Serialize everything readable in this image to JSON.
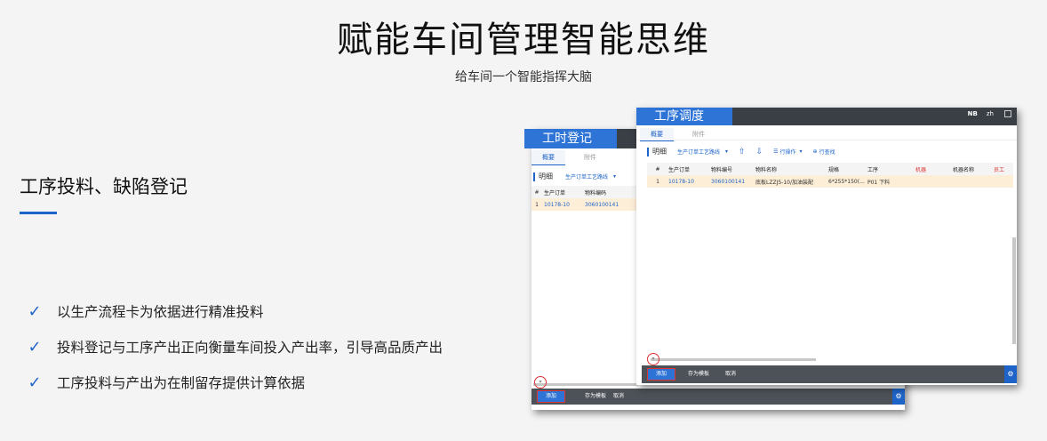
{
  "hero": {
    "title": "赋能车间管理智能思维",
    "subtitle": "给车间一个智能指挥大脑"
  },
  "section": {
    "title": "工序投料、缺陷登记",
    "accent_color": "#1e64c8"
  },
  "bullets": [
    "以生产流程卡为依据进行精准投料",
    "投料登记与工序产出正向衡量车间投入产出率，引导高品质产出",
    "工序投料与产出为在制留存提供计算依据"
  ],
  "icons": {
    "check": "✓",
    "tick": "check-icon",
    "up": "⇧",
    "down": "⇩",
    "caret": "▾",
    "row_op": "☰",
    "fold": "⊕",
    "external": "external-link-icon",
    "settings": "⚙"
  },
  "back_window": {
    "title": "工时登记",
    "tabs": [
      "概要",
      "附件"
    ],
    "detail_label": "明细",
    "view_select": "生产订单工艺路线",
    "columns": [
      "#",
      "生产订单",
      "物料编码"
    ],
    "rows": [
      [
        "1",
        "10178-10",
        "3060100141"
      ]
    ],
    "footer": {
      "add": "添加",
      "save_template": "存为模板",
      "cancel": "取消"
    }
  },
  "front_window": {
    "title": "工序调度",
    "lang": "zh",
    "badge": "NB",
    "tabs": [
      "概要",
      "附件"
    ],
    "detail_label": "明细",
    "view_select": "生产订单工艺路线",
    "row_operation": "行操作",
    "row_find": "行查找",
    "columns": [
      "#",
      "生产订单",
      "物料编号",
      "物料名称",
      "规格",
      "工序",
      "机器",
      "机器名称",
      "员工"
    ],
    "rows": [
      [
        "1",
        "10178-10",
        "3060100141",
        "底板LZZJ5-10/加油装配",
        "6*255*150(...",
        "P01 下料",
        "",
        "",
        ""
      ]
    ],
    "footer": {
      "add": "添加",
      "save_template": "存为模板",
      "cancel": "取消"
    }
  },
  "colors": {
    "accent": "#2e73d6",
    "title_bar": "#3a3f45",
    "footer_bar": "#4d5258",
    "row_highlight": "#fdeed7",
    "alert": "#dd3333"
  }
}
